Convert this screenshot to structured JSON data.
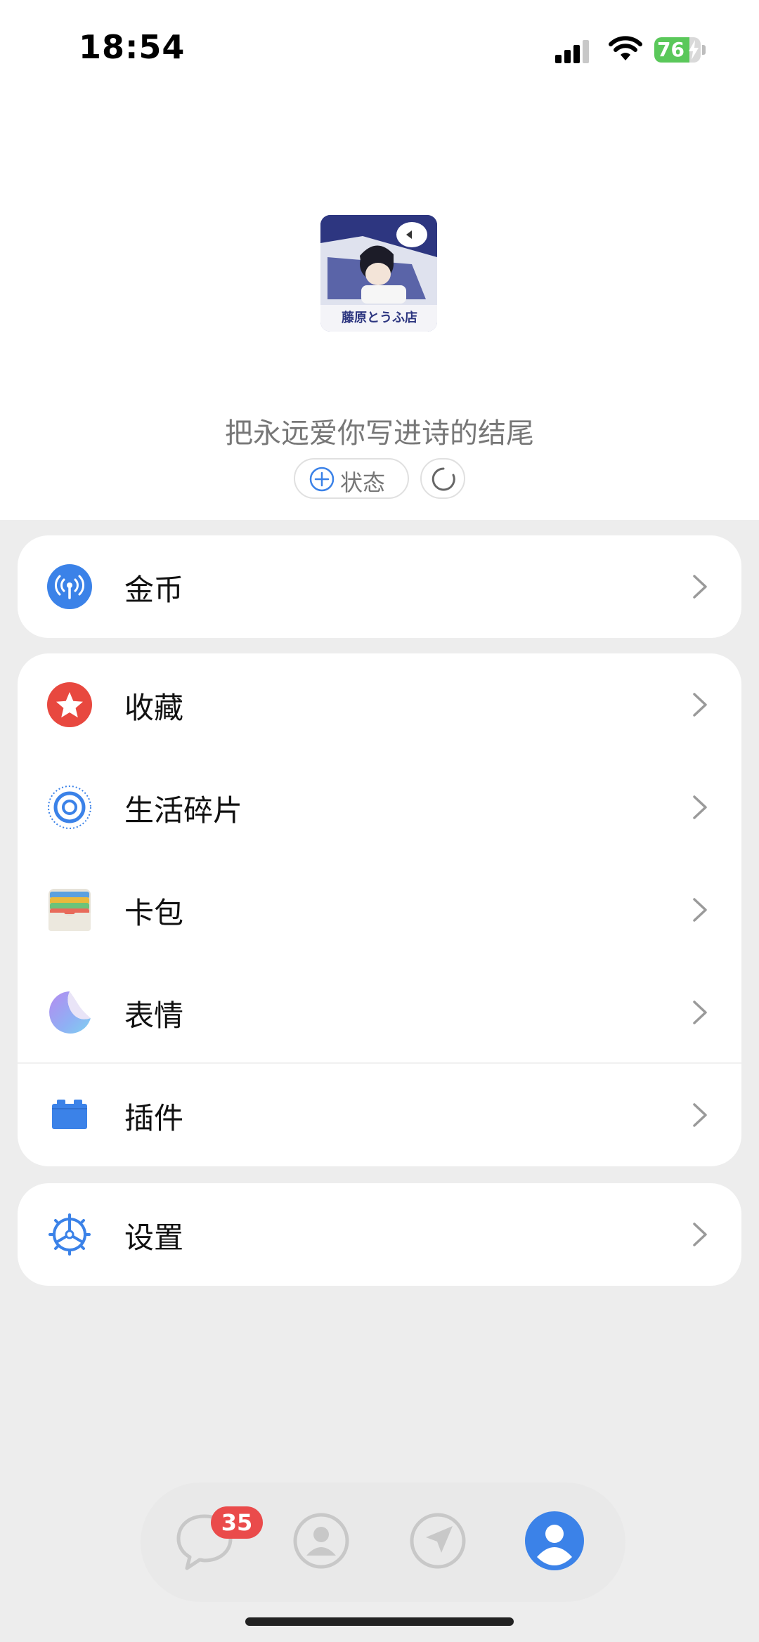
{
  "status_bar": {
    "time": "18:54",
    "battery_percent": "76",
    "battery_level": 0.76,
    "charging": true
  },
  "profile": {
    "signature": "把永远爱你写进诗的结尾",
    "status_button_label": "状态"
  },
  "menu": {
    "coins": {
      "label": "金币",
      "icon": "coins-antenna-icon",
      "color": "#3b82e8"
    },
    "favorites": {
      "label": "收藏",
      "icon": "star-icon",
      "color": "#e8483f"
    },
    "moments": {
      "label": "生活碎片",
      "icon": "moments-target-icon",
      "color": "#3b82e8"
    },
    "wallet": {
      "label": "卡包",
      "icon": "wallet-icon"
    },
    "stickers": {
      "label": "表情",
      "icon": "sticker-icon"
    },
    "plugins": {
      "label": "插件",
      "icon": "plugin-blocks-icon",
      "color": "#3b82e8"
    },
    "settings": {
      "label": "设置",
      "icon": "gear-icon",
      "color": "#3b82e8"
    }
  },
  "tabbar": {
    "chats_badge": "35",
    "active_tab": "me",
    "tabs": [
      "chats-icon",
      "contacts-icon",
      "discover-icon",
      "me-icon"
    ],
    "accent": "#3b82e8"
  }
}
